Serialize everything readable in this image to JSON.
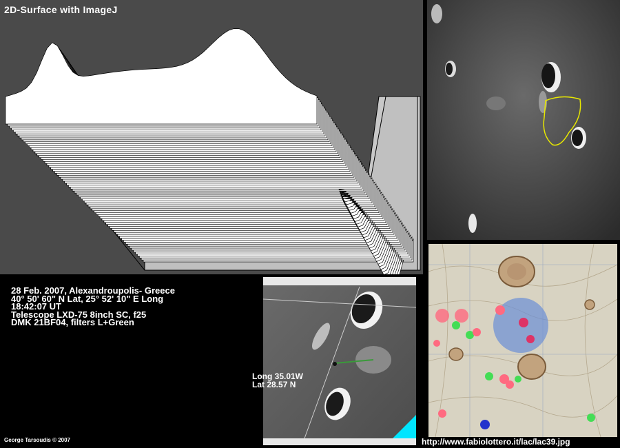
{
  "surface_plot": {
    "title": "2D-Surface with ImageJ"
  },
  "observation": {
    "lines": [
      "28 Feb. 2007, Alexandroupolis- Greece",
      "40° 50' 60\" N Lat, 25° 52' 10\" E Long",
      "18:42:07 UT",
      "Telescope LXD-75 8inch SC, f25",
      "DMK 21BF04, filters L+Green"
    ]
  },
  "coordinates": {
    "long": "Long 35.01W",
    "lat": "Lat 28.57 N"
  },
  "credit": "George Tarsoudis © 2007",
  "source_url": "http://www.fabiolottero.it/lac/lac39.jpg",
  "colors": {
    "panel_gray": "#4a4a4a",
    "outline_yellow": "#e8e800",
    "map_circle_blue": "#6b8fd6",
    "corner_cyan": "#00e5ff"
  }
}
